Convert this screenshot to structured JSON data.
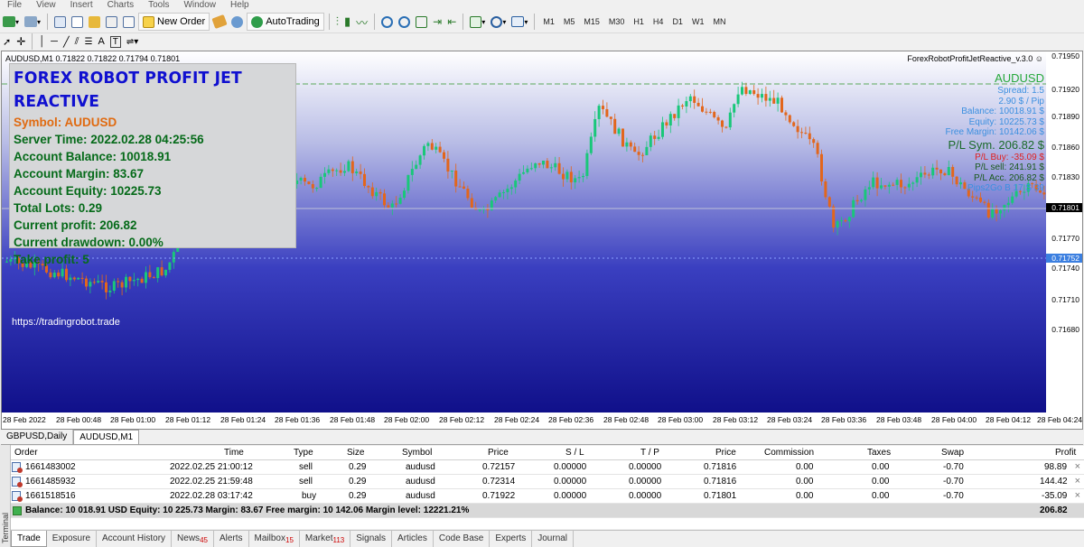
{
  "menu": [
    "File",
    "View",
    "Insert",
    "Charts",
    "Tools",
    "Window",
    "Help"
  ],
  "toolbar": {
    "new_order": "New Order",
    "autotrading": "AutoTrading",
    "timeframes": [
      "M1",
      "M5",
      "M15",
      "M30",
      "H1",
      "H4",
      "D1",
      "W1",
      "MN"
    ]
  },
  "chart": {
    "header": "AUDUSD,M1  0.71822 0.71822 0.71794 0.71801",
    "ea_name": "ForexRobotProfitJetReactive_v.3.0 ☺",
    "url": "https://tradingrobot.trade",
    "panel": {
      "title": "FOREX ROBOT PROFIT JET REACTIVE",
      "symbol": "Symbol: AUDUSD",
      "server_time": "Server Time: 2022.02.28 04:25:56",
      "balance": "Account Balance: 10018.91",
      "margin": "Account Margin: 83.67",
      "equity": "Account Equity: 10225.73",
      "lots": "Total Lots: 0.29",
      "profit": "Current profit: 206.82",
      "drawdown": "Current drawdown:  0.00%",
      "take_profit": "Take profit:  5"
    },
    "right_info": {
      "symbol": "AUDUSD",
      "spread": "Spread: 1.5",
      "pip": "2.90 $ / Pip",
      "balance": "Balance: 10018.91 $",
      "equity": "Equity: 10225.73 $",
      "free_margin": "Free Margin: 10142.06 $",
      "pl_sym": "P/L Sym. 206.82 $",
      "pl_buy": "P/L Buy: -35.09 $",
      "pl_sell": "P/L sell: 241.91 $",
      "pl_acc": "P/L Acc. 206.82 $",
      "pips2go": "Pips2Go B 17 S 39"
    },
    "y_ticks": [
      "0.71950",
      "0.71920",
      "0.71890",
      "0.71860",
      "0.71830",
      "0.71770",
      "0.71740",
      "0.71710",
      "0.71680"
    ],
    "price_badge": "0.71801",
    "level_badge": "0.71752",
    "x_ticks": [
      "28 Feb 2022",
      "28 Feb 00:48",
      "28 Feb 01:00",
      "28 Feb 01:12",
      "28 Feb 01:24",
      "28 Feb 01:36",
      "28 Feb 01:48",
      "28 Feb 02:00",
      "28 Feb 02:12",
      "28 Feb 02:24",
      "28 Feb 02:36",
      "28 Feb 02:48",
      "28 Feb 03:00",
      "28 Feb 03:12",
      "28 Feb 03:24",
      "28 Feb 03:36",
      "28 Feb 03:48",
      "28 Feb 04:00",
      "28 Feb 04:12",
      "28 Feb 04:24"
    ],
    "colors": {
      "bull": "#19c77a",
      "bear": "#e2661c",
      "bg_top": "#ffffff",
      "bg_bottom": "#13138f"
    }
  },
  "chart_tabs": [
    "GBPUSD,Daily",
    "AUDUSD,M1"
  ],
  "terminal": {
    "side_label": "Terminal",
    "headers": [
      "Order",
      "Time",
      "Type",
      "Size",
      "Symbol",
      "Price",
      "S / L",
      "T / P",
      "Price",
      "Commission",
      "Taxes",
      "Swap",
      "Profit"
    ],
    "rows": [
      [
        "1661483002",
        "2022.02.25 21:00:12",
        "sell",
        "0.29",
        "audusd",
        "0.72157",
        "0.00000",
        "0.00000",
        "0.71816",
        "0.00",
        "0.00",
        "-0.70",
        "98.89"
      ],
      [
        "1661485932",
        "2022.02.25 21:59:48",
        "sell",
        "0.29",
        "audusd",
        "0.72314",
        "0.00000",
        "0.00000",
        "0.71816",
        "0.00",
        "0.00",
        "-0.70",
        "144.42"
      ],
      [
        "1661518516",
        "2022.02.28 03:17:42",
        "buy",
        "0.29",
        "audusd",
        "0.71922",
        "0.00000",
        "0.00000",
        "0.71801",
        "0.00",
        "0.00",
        "-0.70",
        "-35.09"
      ]
    ],
    "summary": "Balance: 10 018.91 USD  Equity: 10 225.73  Margin: 83.67  Free margin: 10 142.06  Margin level: 12221.21%",
    "summary_profit": "206.82",
    "close_icon": "×"
  },
  "bottom_tabs": [
    {
      "label": "Trade",
      "badge": ""
    },
    {
      "label": "Exposure",
      "badge": ""
    },
    {
      "label": "Account History",
      "badge": ""
    },
    {
      "label": "News",
      "badge": "45"
    },
    {
      "label": "Alerts",
      "badge": ""
    },
    {
      "label": "Mailbox",
      "badge": "15"
    },
    {
      "label": "Market",
      "badge": "113"
    },
    {
      "label": "Signals",
      "badge": ""
    },
    {
      "label": "Articles",
      "badge": ""
    },
    {
      "label": "Code Base",
      "badge": ""
    },
    {
      "label": "Experts",
      "badge": ""
    },
    {
      "label": "Journal",
      "badge": ""
    }
  ]
}
